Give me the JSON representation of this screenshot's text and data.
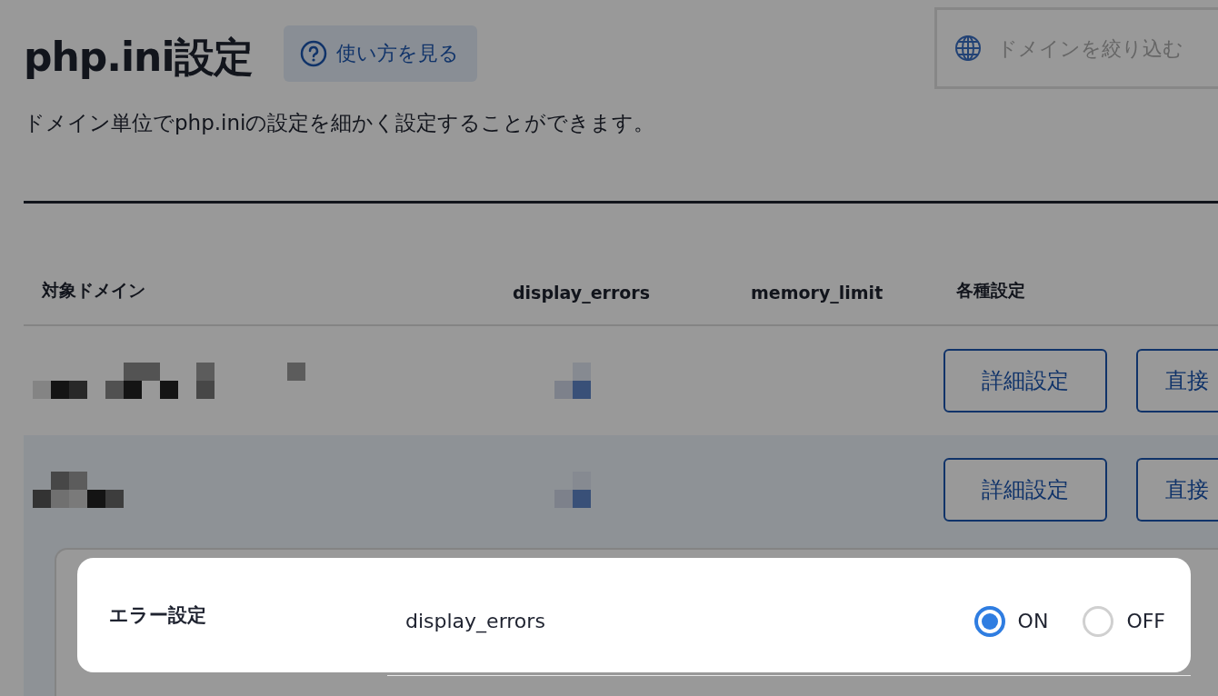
{
  "page": {
    "title": "php.ini設定",
    "help_button": "使い方を見る",
    "description": "ドメイン単位でphp.iniの設定を細かく設定することができます。",
    "search": {
      "placeholder": "ドメインを絞り込む"
    }
  },
  "table": {
    "columns": [
      "対象ドメイン",
      "display_errors",
      "memory_limit",
      "各種設定"
    ],
    "rows": [
      {
        "expanded": false,
        "actions": [
          "詳細設定",
          "直接"
        ]
      },
      {
        "expanded": true,
        "actions": [
          "詳細設定",
          "直接"
        ]
      }
    ]
  },
  "settings_panel": {
    "section": "エラー設定",
    "setting": "display_errors",
    "options": [
      {
        "label": "ON",
        "selected": true
      },
      {
        "label": "OFF",
        "selected": false
      }
    ]
  }
}
